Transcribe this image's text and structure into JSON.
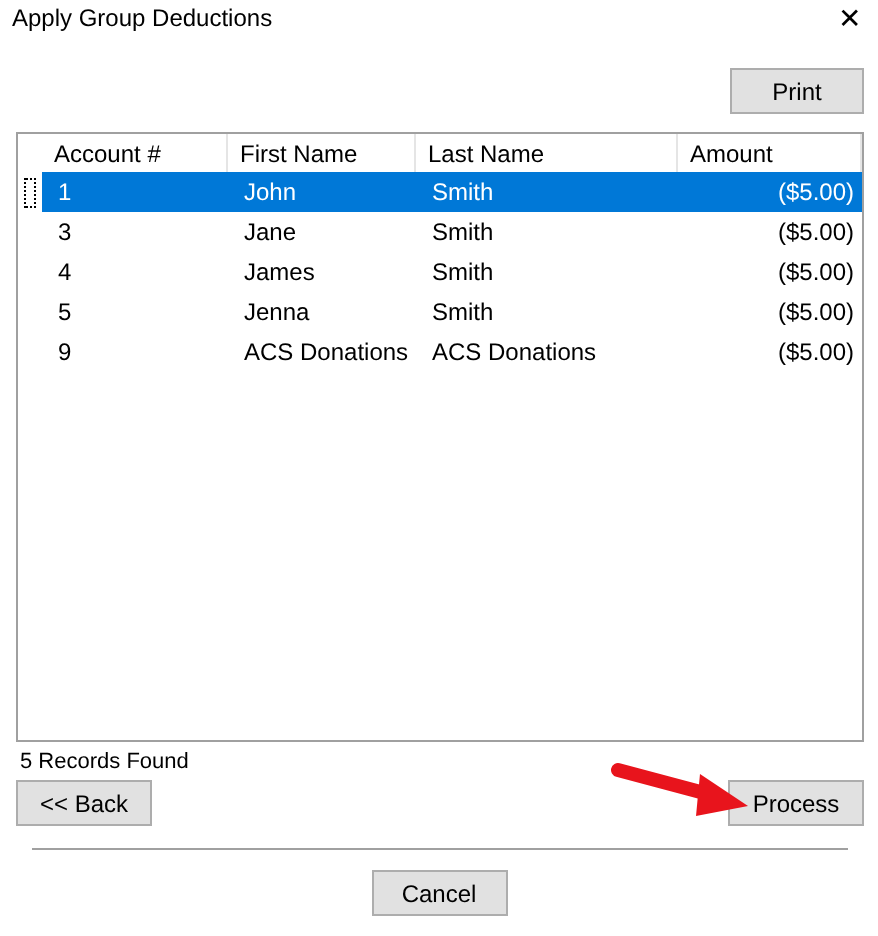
{
  "window": {
    "title": "Apply Group Deductions",
    "close": "✕"
  },
  "print_button": "Print",
  "table": {
    "columns": [
      "Account #",
      "First Name",
      "Last Name",
      "Amount"
    ],
    "rows": [
      {
        "cells": [
          "1",
          "John",
          "Smith",
          "($5.00)"
        ],
        "selected": true
      },
      {
        "cells": [
          "3",
          "Jane",
          "Smith",
          "($5.00)"
        ],
        "selected": false
      },
      {
        "cells": [
          "4",
          "James",
          "Smith",
          "($5.00)"
        ],
        "selected": false
      },
      {
        "cells": [
          "5",
          "Jenna",
          "Smith",
          "($5.00)"
        ],
        "selected": false
      },
      {
        "cells": [
          "9",
          "ACS Donations",
          "ACS Donations",
          "($5.00)"
        ],
        "selected": false
      }
    ]
  },
  "status": "5 Records Found",
  "back_button": "<< Back",
  "process_button": "Process",
  "cancel_button": "Cancel"
}
